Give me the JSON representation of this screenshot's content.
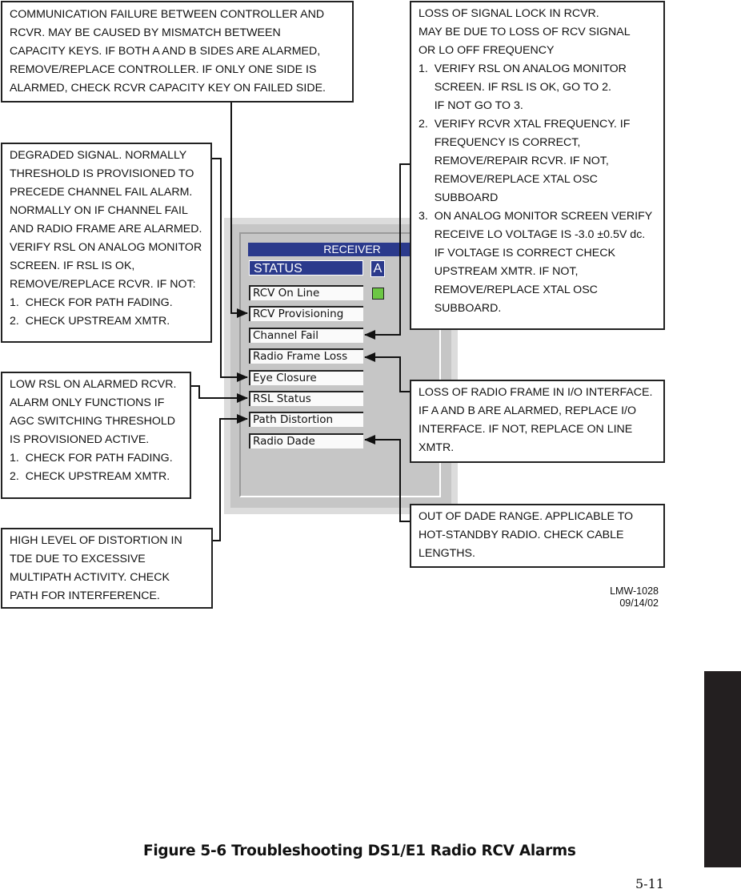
{
  "receiver_panel": {
    "title": "RECEIVER",
    "status_label": "STATUS",
    "side_label": "A",
    "fields": [
      "RCV On Line",
      "RCV Provisioning",
      "Channel Fail",
      "Radio Frame Loss",
      "Eye Closure",
      "RSL Status",
      "Path Distortion",
      "Radio Dade"
    ],
    "online_led_color": "#6cc644",
    "header_color": "#2b3a8c"
  },
  "callouts": {
    "comm_failure": [
      "COMMUNICATION FAILURE BETWEEN CONTROLLER AND",
      "RCVR. MAY BE CAUSED BY MISMATCH BETWEEN",
      "CAPACITY KEYS. IF BOTH A AND B SIDES ARE ALARMED,",
      "REMOVE/REPLACE CONTROLLER. IF ONLY ONE SIDE IS",
      "ALARMED, CHECK RCVR CAPACITY KEY ON FAILED SIDE."
    ],
    "degraded": [
      "DEGRADED SIGNAL. NORMALLY",
      "THRESHOLD IS PROVISIONED TO",
      "PRECEDE CHANNEL FAIL ALARM.",
      "NORMALLY ON IF CHANNEL FAIL",
      "AND RADIO FRAME ARE ALARMED.",
      "VERIFY RSL ON ANALOG MONITOR",
      "SCREEN. IF RSL IS OK,",
      "REMOVE/REPLACE RCVR. IF NOT:",
      "1.  CHECK FOR PATH FADING.",
      "2.  CHECK UPSTREAM XMTR."
    ],
    "low_rsl": [
      "LOW RSL ON ALARMED RCVR.",
      "ALARM ONLY FUNCTIONS IF",
      "AGC SWITCHING THRESHOLD",
      "IS PROVISIONED ACTIVE.",
      "1.  CHECK FOR PATH FADING.",
      "2.  CHECK UPSTREAM XMTR."
    ],
    "distortion": [
      "HIGH LEVEL OF DISTORTION IN",
      "TDE DUE TO EXCESSIVE",
      "MULTIPATH ACTIVITY. CHECK",
      "PATH FOR INTERFERENCE."
    ],
    "signal_lock": [
      "LOSS OF SIGNAL LOCK IN RCVR.",
      "MAY BE DUE TO LOSS OF RCV SIGNAL",
      "OR LO OFF FREQUENCY",
      "1.  VERIFY RSL ON ANALOG MONITOR",
      "     SCREEN. IF RSL IS OK, GO TO 2.",
      "     IF NOT GO TO 3.",
      "2.  VERIFY RCVR XTAL FREQUENCY. IF",
      "     FREQUENCY IS CORRECT,",
      "     REMOVE/REPAIR RCVR. IF NOT,",
      "     REMOVE/REPLACE XTAL OSC",
      "     SUBBOARD",
      "3.  ON ANALOG MONITOR SCREEN VERIFY",
      "     RECEIVE LO VOLTAGE IS -3.0 ±0.5V dc.",
      "     IF VOLTAGE IS CORRECT CHECK",
      "     UPSTREAM XMTR. IF NOT,",
      "     REMOVE/REPLACE XTAL OSC",
      "     SUBBOARD."
    ],
    "radio_frame": [
      "LOSS OF RADIO FRAME IN I/O INTERFACE.",
      "IF A AND B ARE ALARMED, REPLACE I/O",
      "INTERFACE. IF NOT, REPLACE ON LINE",
      "XMTR."
    ],
    "dade": [
      "OUT OF DADE RANGE. APPLICABLE TO",
      "HOT-STANDBY RADIO. CHECK CABLE",
      "LENGTHS."
    ]
  },
  "drawing_code": "LMW-1028",
  "drawing_date": "09/14/02",
  "caption": "Figure 5-6  Troubleshooting DS1/E1 Radio RCV Alarms",
  "page_number": "5-11"
}
